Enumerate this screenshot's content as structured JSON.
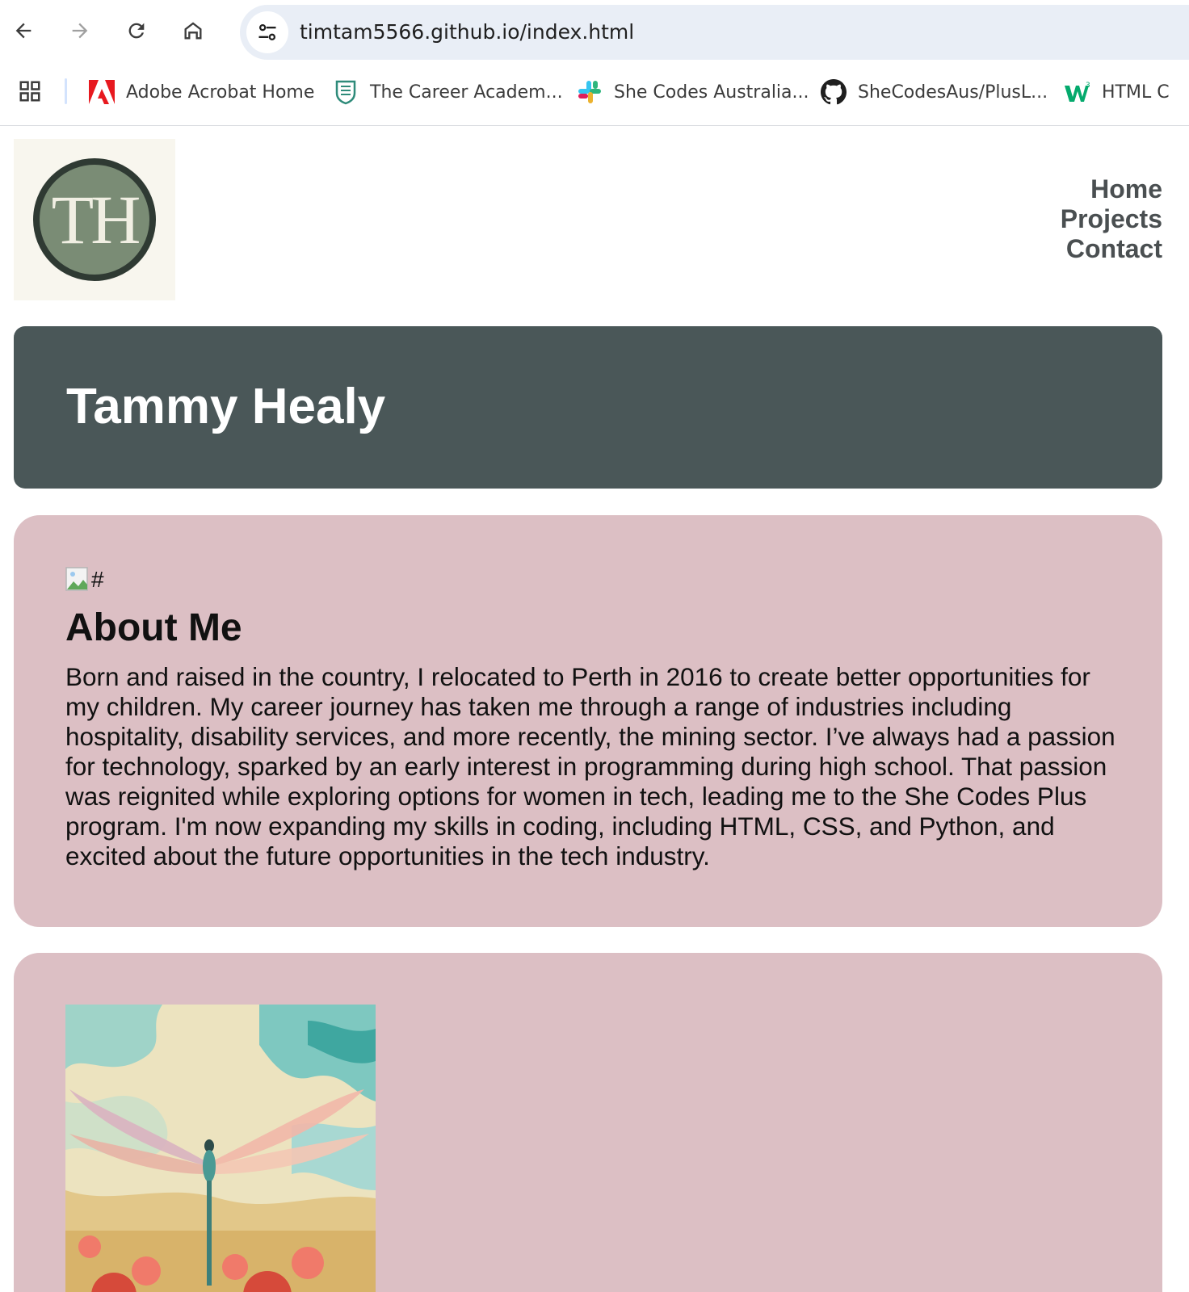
{
  "browser": {
    "url": "timtam5566.github.io/index.html",
    "bookmarks": [
      {
        "label": "Adobe Acrobat Home",
        "icon": "adobe-acrobat-icon"
      },
      {
        "label": "The Career Academ...",
        "icon": "career-academy-icon"
      },
      {
        "label": "She Codes Australia...",
        "icon": "slack-icon"
      },
      {
        "label": "SheCodesAus/PlusL...",
        "icon": "github-icon"
      },
      {
        "label": "HTML C",
        "icon": "w3schools-icon"
      }
    ]
  },
  "site": {
    "logo_text": "TH",
    "nav": [
      "Home",
      "Projects",
      "Contact"
    ],
    "hero_title": "Tammy Healy",
    "about": {
      "image_alt": "#",
      "title": "About Me",
      "text": "Born and raised in the country, I relocated to Perth in 2016 to create better opportunities for my children. My career journey has taken me through a range of industries including hospitality, disability services, and more recently, the mining sector. I’ve always had a passion for technology, sparked by an early interest in programming during high school. That passion was reignited while exploring options for women in tech, leading me to the She Codes Plus program. I'm now expanding my skills in coding, including HTML, CSS, and Python, and excited about the future opportunities in the tech industry."
    }
  },
  "colors": {
    "hero_bg": "#4a5758",
    "card_bg": "#dcbfc4",
    "logo_bg": "#f8f6ee",
    "logo_circle": "#7a8c75",
    "nav_text": "#4a4f51"
  }
}
